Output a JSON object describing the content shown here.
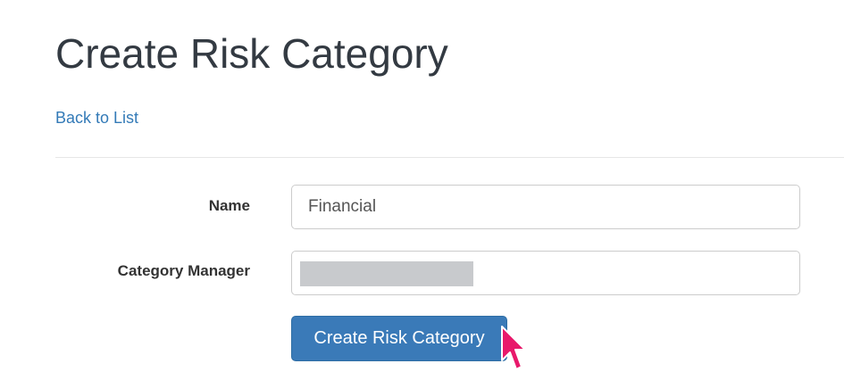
{
  "page": {
    "title": "Create Risk Category",
    "back_link": "Back to List"
  },
  "form": {
    "name": {
      "label": "Name",
      "value": "Financial"
    },
    "category_manager": {
      "label": "Category Manager",
      "value": ""
    },
    "submit_label": "Create Risk Category"
  },
  "colors": {
    "link": "#337ab7",
    "primary_button": "#3a7ab8",
    "cursor": "#e8196b",
    "redaction": "#c8cacd"
  },
  "icons": {
    "cursor": "pointer-arrow-icon"
  }
}
